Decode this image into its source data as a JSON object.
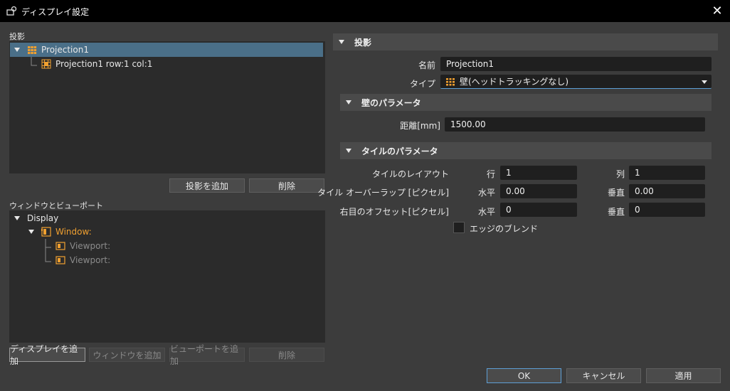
{
  "window": {
    "title": "ディスプレイ設定"
  },
  "projection_panel": {
    "label": "投影",
    "items": [
      "Projection1",
      "Projection1 row:1 col:1"
    ],
    "add_label": "投影を追加",
    "delete_label": "削除"
  },
  "window_panel": {
    "label": "ウィンドウとビューポート",
    "items": [
      "Display",
      "Window:",
      "Viewport:",
      "Viewport:"
    ],
    "add_display_label": "ディスプレイを追加",
    "add_window_label": "ウィンドウを追加",
    "add_viewport_label": "ビューポートを追加",
    "delete_label": "削除"
  },
  "projection_props": {
    "header": "投影",
    "name_label": "名前",
    "name_value": "Projection1",
    "type_label": "タイプ",
    "type_value": "壁(ヘッドトラッキングなし)"
  },
  "wall_params": {
    "header": "壁のパラメータ",
    "distance_label": "距離[mm]",
    "distance_value": "1500.00"
  },
  "tile_params": {
    "header": "タイルのパラメータ",
    "layout_label": "タイルのレイアウト",
    "row_label": "行",
    "row_value": "1",
    "col_label": "列",
    "col_value": "1",
    "overlap_label": "タイル オーバーラップ [ピクセル]",
    "overlap_h_label": "水平",
    "overlap_h_value": "0.00",
    "overlap_v_label": "垂直",
    "overlap_v_value": "0.00",
    "offset_label": "右目のオフセット[ピクセル]",
    "offset_h_label": "水平",
    "offset_h_value": "0",
    "offset_v_label": "垂直",
    "offset_v_value": "0",
    "blend_label": "エッジのブレンド"
  },
  "footer": {
    "ok_label": "OK",
    "cancel_label": "キャンセル",
    "apply_label": "適用"
  },
  "colors": {
    "accent": "#5d9fd6",
    "selection": "#4a6f88",
    "icon_orange": "#f0a030"
  }
}
